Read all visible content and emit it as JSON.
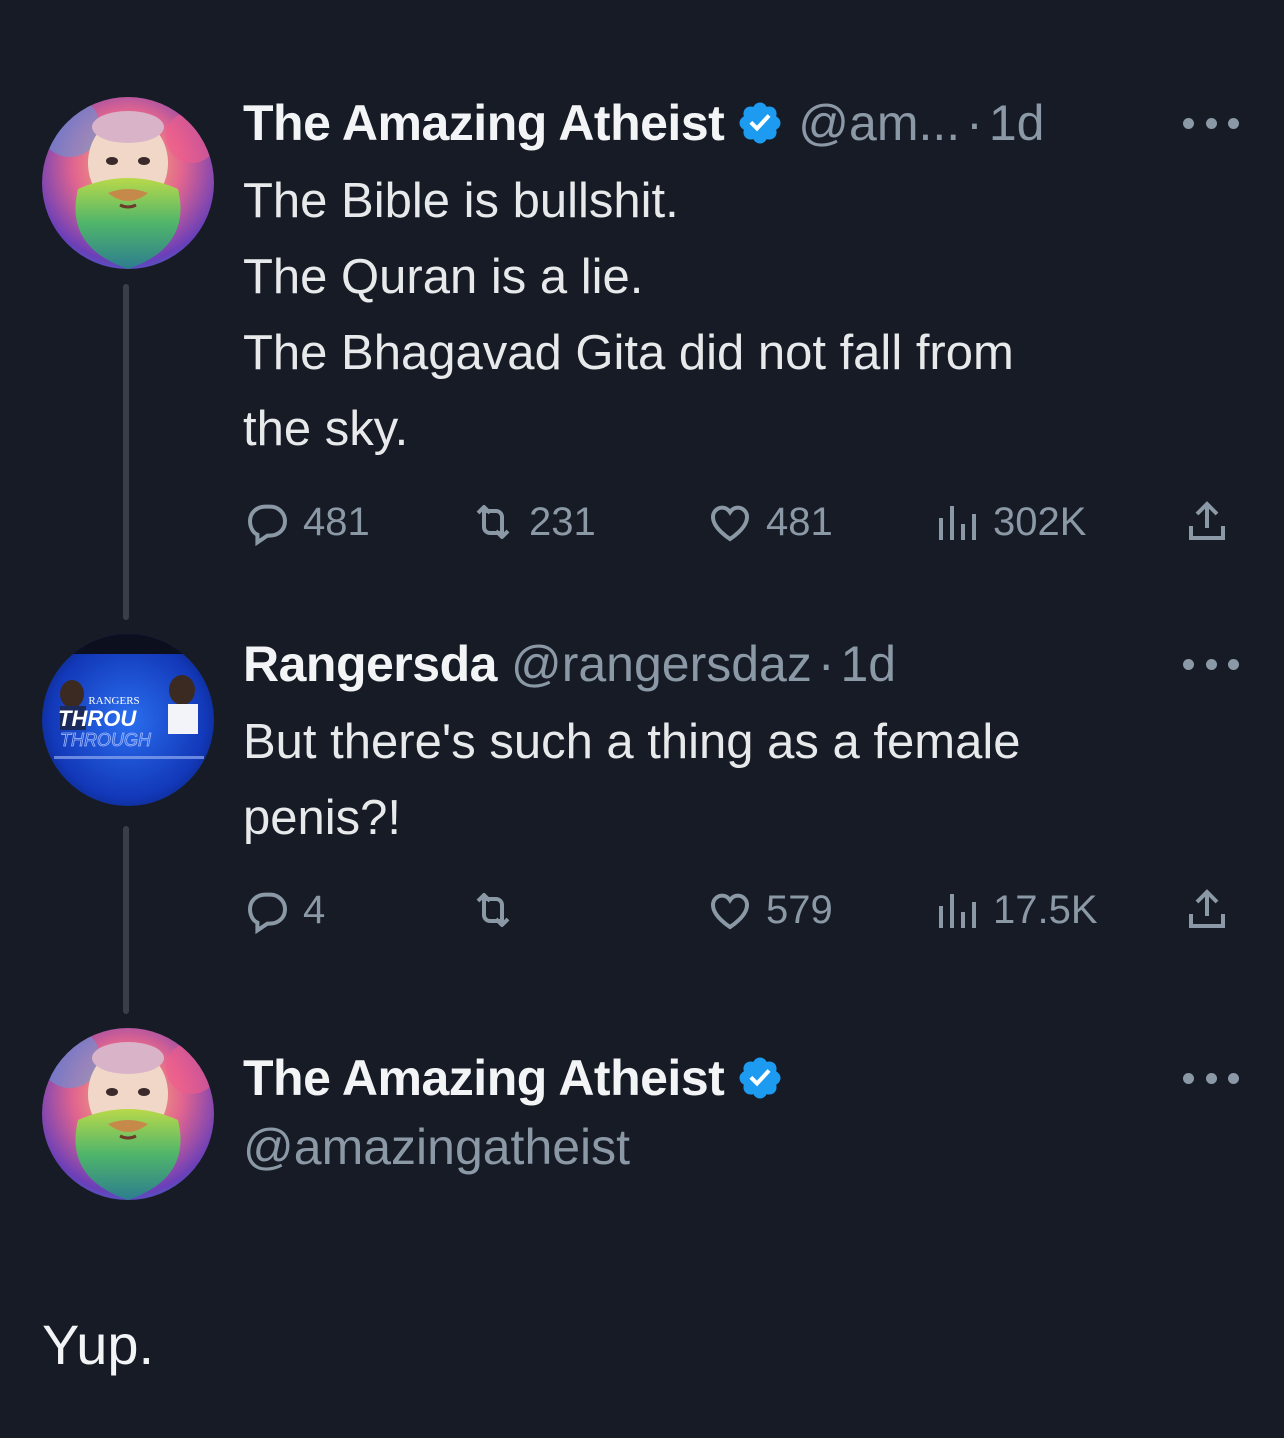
{
  "tweets": [
    {
      "display_name": "The Amazing Atheist",
      "verified": true,
      "handle": "@am...",
      "separator": "·",
      "time": "1d",
      "text_lines": [
        "The Bible is bullshit.",
        "The Quran is a lie.",
        "The Bhagavad Gita did not fall from",
        "the sky."
      ],
      "stats": {
        "replies": "481",
        "retweets": "231",
        "likes": "481",
        "views": "302K"
      }
    },
    {
      "display_name": "Rangersda",
      "verified": false,
      "handle": "@rangersdaz",
      "separator": "·",
      "time": "1d",
      "text_lines": [
        "But there's such a thing as a female",
        "penis?!"
      ],
      "stats": {
        "replies": "4",
        "retweets": "",
        "likes": "579",
        "views": "17.5K"
      },
      "avatar_text": {
        "top": "RANGERS",
        "main": "THROU",
        "sub": "THROUGH"
      }
    },
    {
      "display_name": "The Amazing Atheist",
      "verified": true,
      "handle": "@amazingatheist"
    }
  ],
  "caption": "Yup.",
  "icons": {
    "reply": "reply-icon",
    "retweet": "retweet-icon",
    "like": "heart-icon",
    "views": "views-icon",
    "share": "share-icon",
    "more": "more-icon",
    "verified": "verified-badge-icon"
  },
  "colors": {
    "background": "#161b26",
    "verified_blue": "#1d9bf0",
    "muted_text": "#8b98a5",
    "primary_text": "#e7e9ea"
  }
}
